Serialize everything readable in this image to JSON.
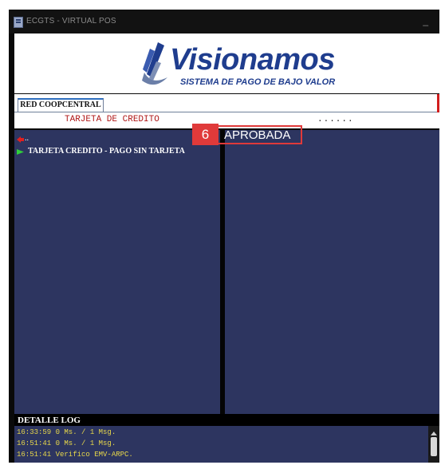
{
  "window": {
    "title": "ECGTS - VIRTUAL POS",
    "minimize_label": "_"
  },
  "logo": {
    "word": "Visionamos",
    "tagline": "SISTEMA DE PAGO DE BAJO VALOR",
    "brand_color": "#1f3d8e"
  },
  "tabs": [
    {
      "label": "RED COOPCENTRAL",
      "active": true
    }
  ],
  "infobar": {
    "label": "TARJETA DE CREDITO",
    "value": "......"
  },
  "menu": {
    "back_label": "..",
    "items": [
      {
        "label": "TARJETA CREDITO - PAGO SIN TARJETA",
        "icon": "green-flag-icon"
      }
    ]
  },
  "callout": {
    "step": "6"
  },
  "status": {
    "text": "APROBADA",
    "highlight_color": "#e03a3a"
  },
  "log": {
    "title": "DETALLE LOG",
    "lines": [
      "16:33:59 0 Ms. / 1 Msg.",
      "16:51:41 0 Ms. / 1 Msg.",
      "16:51:41 Verifico EMV-ARPC."
    ]
  },
  "colors": {
    "pane_bg": "#2d3560",
    "log_text": "#e8d84a",
    "accent_red": "#d21e1e"
  }
}
